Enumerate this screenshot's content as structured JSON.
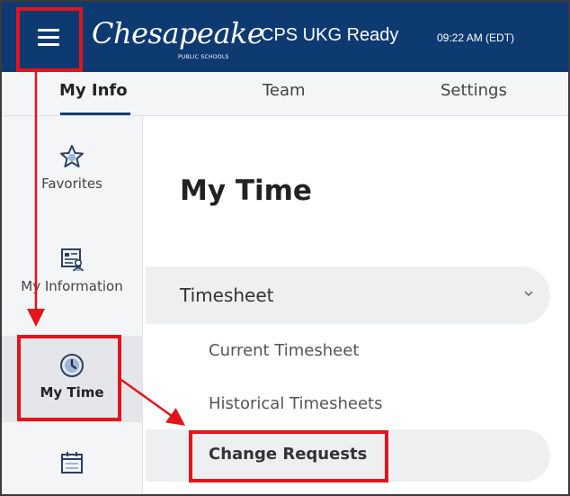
{
  "header": {
    "logo_script": "Chesapeake",
    "logo_sub": "PUBLIC SCHOOLS",
    "app_title": "CPS UKG Ready",
    "clock": "09:22 AM (EDT)"
  },
  "tabs": [
    {
      "label": "My Info",
      "active": true
    },
    {
      "label": "Team",
      "active": false
    },
    {
      "label": "Settings",
      "active": false
    }
  ],
  "sidebar": {
    "items": [
      {
        "label": "Favorites",
        "icon": "star-icon"
      },
      {
        "label": "My Information",
        "icon": "id-card-icon"
      },
      {
        "label": "My Time",
        "icon": "clock-icon",
        "active": true
      },
      {
        "label": "",
        "icon": "calendar-icon"
      }
    ]
  },
  "main": {
    "title": "My Time",
    "section": {
      "label": "Timesheet",
      "expanded": true
    },
    "sub_items": [
      {
        "label": "Current Timesheet"
      },
      {
        "label": "Historical Timesheets"
      },
      {
        "label": "Change Requests",
        "active": true
      }
    ]
  },
  "colors": {
    "header_bg": "#0e3a72",
    "annotation": "#e3141b",
    "nav_bg": "#f4f5f6"
  }
}
